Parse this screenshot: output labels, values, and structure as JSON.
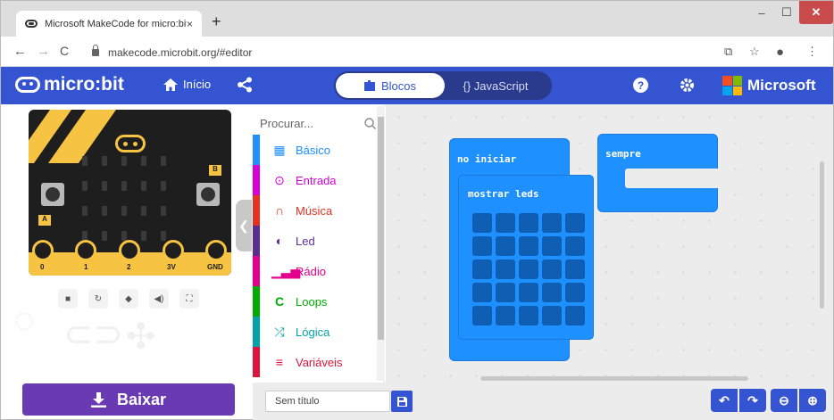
{
  "browser": {
    "tab_title": "Microsoft MakeCode for micro:bit",
    "tab_close": "×",
    "new_tab": "+",
    "url": "makecode.microbit.org/#editor",
    "back": "←",
    "forward": "→",
    "reload": "C"
  },
  "header": {
    "logo_text": "micro:bit",
    "home_label": "Início",
    "blocks_label": "Blocos",
    "js_label": "{} JavaScript",
    "brand": "Microsoft"
  },
  "simulator": {
    "pins": [
      "0",
      "1",
      "2",
      "3V",
      "GND"
    ],
    "button_a": "A",
    "button_b": "B"
  },
  "toolbox": {
    "search_placeholder": "Procurar...",
    "categories": [
      {
        "label": "Básico",
        "color": "#1e90ff",
        "icon": "grid-icon"
      },
      {
        "label": "Entrada",
        "color": "#d400d4",
        "icon": "target-icon"
      },
      {
        "label": "Música",
        "color": "#e63022",
        "icon": "headphones-icon"
      },
      {
        "label": "Led",
        "color": "#5c2d91",
        "icon": "toggle-icon"
      },
      {
        "label": "Rádio",
        "color": "#e3008c",
        "icon": "signal-bars-icon"
      },
      {
        "label": "Loops",
        "color": "#00aa00",
        "icon": "loop-icon"
      },
      {
        "label": "Lógica",
        "color": "#00a4a6",
        "icon": "shuffle-icon"
      },
      {
        "label": "Variáveis",
        "color": "#dc143c",
        "icon": "list-icon"
      }
    ]
  },
  "workspace": {
    "on_start_label": "no iniciar",
    "show_leds_label": "mostrar leds",
    "forever_label": "sempre"
  },
  "footer": {
    "download_label": "Baixar",
    "project_name": "Sem título"
  },
  "colors": {
    "header": "#3454d1",
    "download": "#6a3ab2",
    "block": "#1e90ff"
  }
}
